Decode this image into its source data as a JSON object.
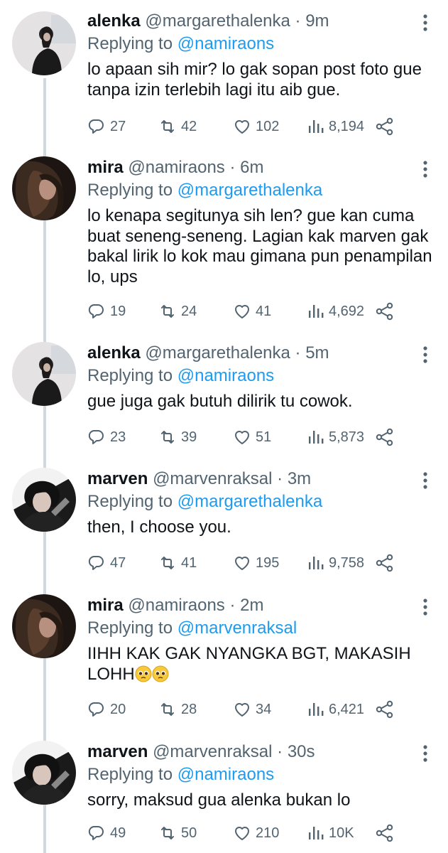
{
  "tweets": [
    {
      "name": "alenka",
      "handle": "@margarethalenka",
      "time": "9m",
      "replying_label": "Replying to",
      "replying_to": "@namiraons",
      "text": "lo apaan sih mir? lo gak sopan post foto gue tanpa izin terlebih lagi itu aib gue.",
      "replies": "27",
      "retweets": "42",
      "likes": "102",
      "views": "8,194"
    },
    {
      "name": "mira",
      "handle": "@namiraons",
      "time": "6m",
      "replying_label": "Replying to",
      "replying_to": "@margarethalenka",
      "text": "lo kenapa segitunya sih len? gue kan cuma buat seneng-seneng. Lagian kak marven gak bakal lirik lo kok mau gimana pun penampilan lo, ups",
      "replies": "19",
      "retweets": "24",
      "likes": "41",
      "views": "4,692"
    },
    {
      "name": "alenka",
      "handle": "@margarethalenka",
      "time": "5m",
      "replying_label": "Replying to",
      "replying_to": "@namiraons",
      "text": "gue juga gak butuh dilirik tu cowok.",
      "replies": "23",
      "retweets": "39",
      "likes": "51",
      "views": "5,873"
    },
    {
      "name": "marven",
      "handle": "@marvenraksal",
      "time": "3m",
      "replying_label": "Replying to",
      "replying_to": "@margarethalenka",
      "text": "then, I choose you.",
      "replies": "47",
      "retweets": "41",
      "likes": "195",
      "views": "9,758"
    },
    {
      "name": "mira",
      "handle": "@namiraons",
      "time": "2m",
      "replying_label": "Replying to",
      "replying_to": "@marvenraksal",
      "text": "IIHH KAK GAK NYANGKA BGT, MAKASIH LOHH",
      "replies": "20",
      "retweets": "28",
      "likes": "34",
      "views": "6,421"
    },
    {
      "name": "marven",
      "handle": "@marvenraksal",
      "time": "30s",
      "replying_label": "Replying to",
      "replying_to": "@namiraons",
      "text": "sorry, maksud gua alenka bukan lo",
      "replies": "49",
      "retweets": "50",
      "likes": "210",
      "views": "10K"
    }
  ],
  "separator": "·",
  "icons": {
    "reply": "reply-icon",
    "retweet": "retweet-icon",
    "like": "heart-icon",
    "views": "views-icon",
    "share": "share-icon",
    "more": "more-vertical-icon",
    "emoji": "pleading-face-emoji"
  },
  "colors": {
    "link": "#1d9bf0",
    "secondary_text": "#536471",
    "thread_line": "#cfd9de"
  }
}
